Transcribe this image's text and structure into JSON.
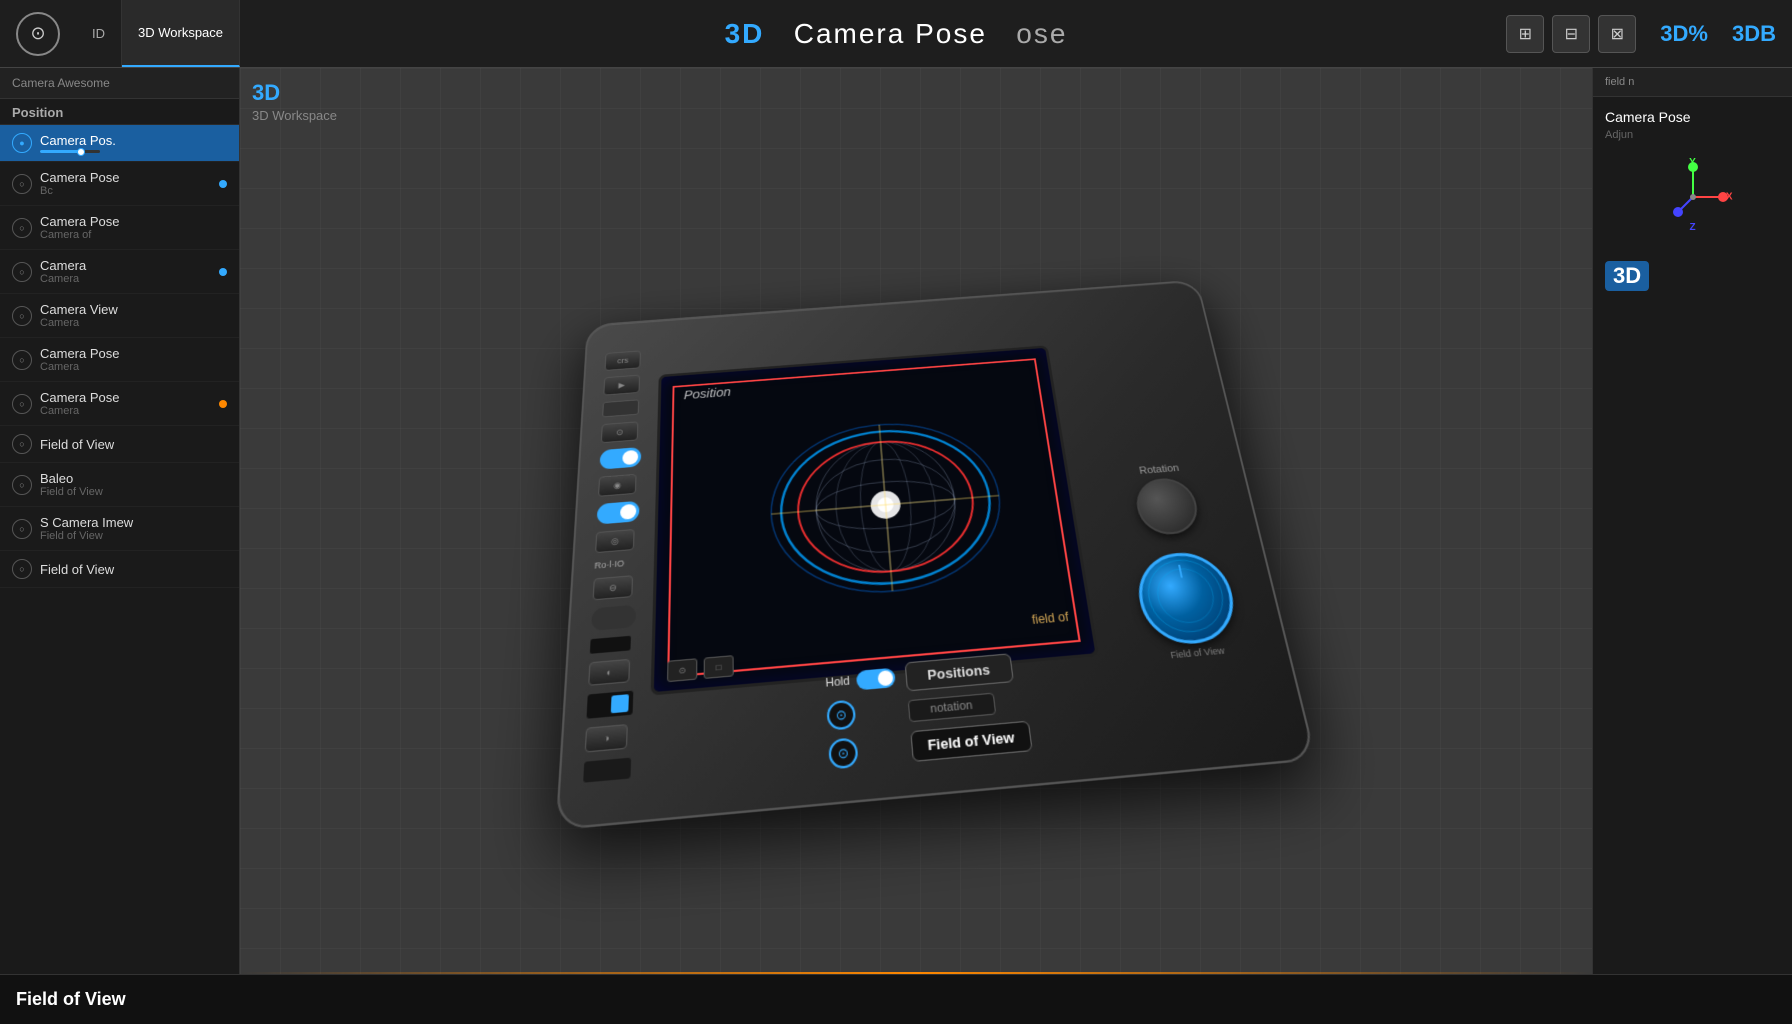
{
  "topbar": {
    "logo_symbol": "⊙",
    "tabs": [
      {
        "id": "id",
        "label": "ID",
        "active": false
      },
      {
        "id": "viewport",
        "label": "3D Workspace",
        "active": true
      }
    ],
    "title": "Camera Pose",
    "title_prefix": "3D",
    "title_suffix": "ose",
    "icon_buttons": [
      "⊞",
      "⊟",
      "⊠"
    ],
    "view_label": "3D%",
    "view_label2": "3DB"
  },
  "sidebar": {
    "header": "Camera Awesome",
    "position_label": "Position",
    "items": [
      {
        "label": "Camera Pos.",
        "sub": "",
        "active": true,
        "dot": null
      },
      {
        "label": "Camera Pose",
        "sub": "Bc",
        "active": false,
        "dot": "blue"
      },
      {
        "label": "Camera Pose",
        "sub": "Camera of",
        "active": false,
        "dot": null
      },
      {
        "label": "Camera",
        "sub": "Camera",
        "active": false,
        "dot": "blue"
      },
      {
        "label": "Camera View",
        "sub": "Camera",
        "active": false,
        "dot": null
      },
      {
        "label": "Camera Pose",
        "sub": "Camera",
        "active": false,
        "dot": null
      },
      {
        "label": "Camera Pose",
        "sub": "Camera",
        "active": false,
        "dot": "orange"
      },
      {
        "label": "Field of View",
        "sub": "",
        "active": false,
        "dot": null
      },
      {
        "label": "Baleo",
        "sub": "Field of View",
        "active": false,
        "dot": null
      },
      {
        "label": "S Camera Imew",
        "sub": "Field of View",
        "active": false,
        "dot": null
      },
      {
        "label": "Field of View",
        "sub": "",
        "active": false,
        "dot": null
      }
    ]
  },
  "viewport": {
    "label_3d": "3D",
    "subtitle": "3D Workspace",
    "camera_label": "Camera Pose",
    "camera_sub": "Adjun"
  },
  "device": {
    "screen_labels": {
      "position": "Position",
      "field_of": "field of"
    },
    "bottom_buttons": [
      "Positions",
      "Rotation",
      "Field of View"
    ],
    "bottom_labels_side": [
      "rotation",
      "notation"
    ],
    "knob_labels": [
      "Rotation",
      "Field of View"
    ]
  },
  "right_panel": {
    "header": "field n",
    "title": "Camera Pose",
    "sub": "Adjun"
  },
  "status_bar": {
    "field_of_view": "Field of View"
  }
}
